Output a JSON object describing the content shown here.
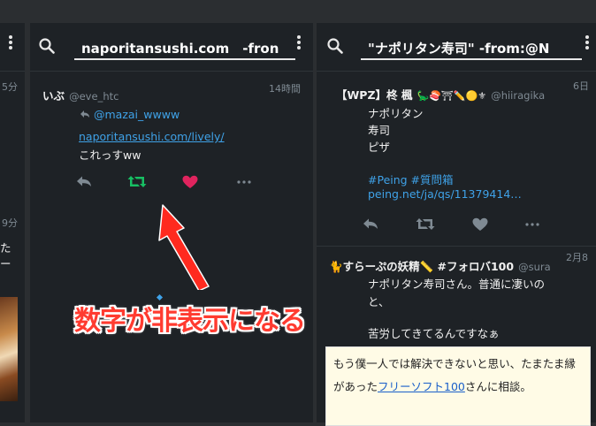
{
  "colors": {
    "accent": "#3fa2e8",
    "retweet": "#17bf63",
    "like": "#e0245e",
    "annotation": "#ff3b30"
  },
  "left_column": {
    "time_1": "5分",
    "time_2": "9分",
    "text_1": "た",
    "text_2": "ー"
  },
  "col2": {
    "search_value": "naporitansushi.com　-fron",
    "tweet": {
      "name": "いぶ",
      "handle": "@eve_htc",
      "time": "14時間",
      "reply_to": "@mazai_wwww",
      "link": "naporitansushi.com/lively/",
      "text": "これっすww"
    }
  },
  "col3": {
    "search_value": "\"ナポリタン寿司\" -from:@N",
    "tweet1": {
      "name": "【WPZ】柊 楓",
      "emoji": "🦕🍣⛩✏️🟡⚜",
      "handle": "@hiiragika",
      "time": "6日",
      "lines": [
        "ナポリタン",
        "寿司",
        "ピザ"
      ],
      "hashtags": "#Peing #質問箱",
      "link": "peing.net/ja/qs/11379414…"
    },
    "tweet2": {
      "name": "🐈すらーぷの妖精📏 #フォロバ100",
      "handle": "@sura",
      "time": "2月8",
      "line1": "ナポリタン寿司さん。普通に凄いの",
      "line2": "と、",
      "line3": "苦労してきてるんですなぁ"
    },
    "card": {
      "line1": "もう僕一人では解決できないと思い、たまたま縁",
      "line2_pre": "があった",
      "line2_link": "フリーソフト100",
      "line2_post": "さんに相談。"
    }
  },
  "annotation": "数字が非表示になる"
}
